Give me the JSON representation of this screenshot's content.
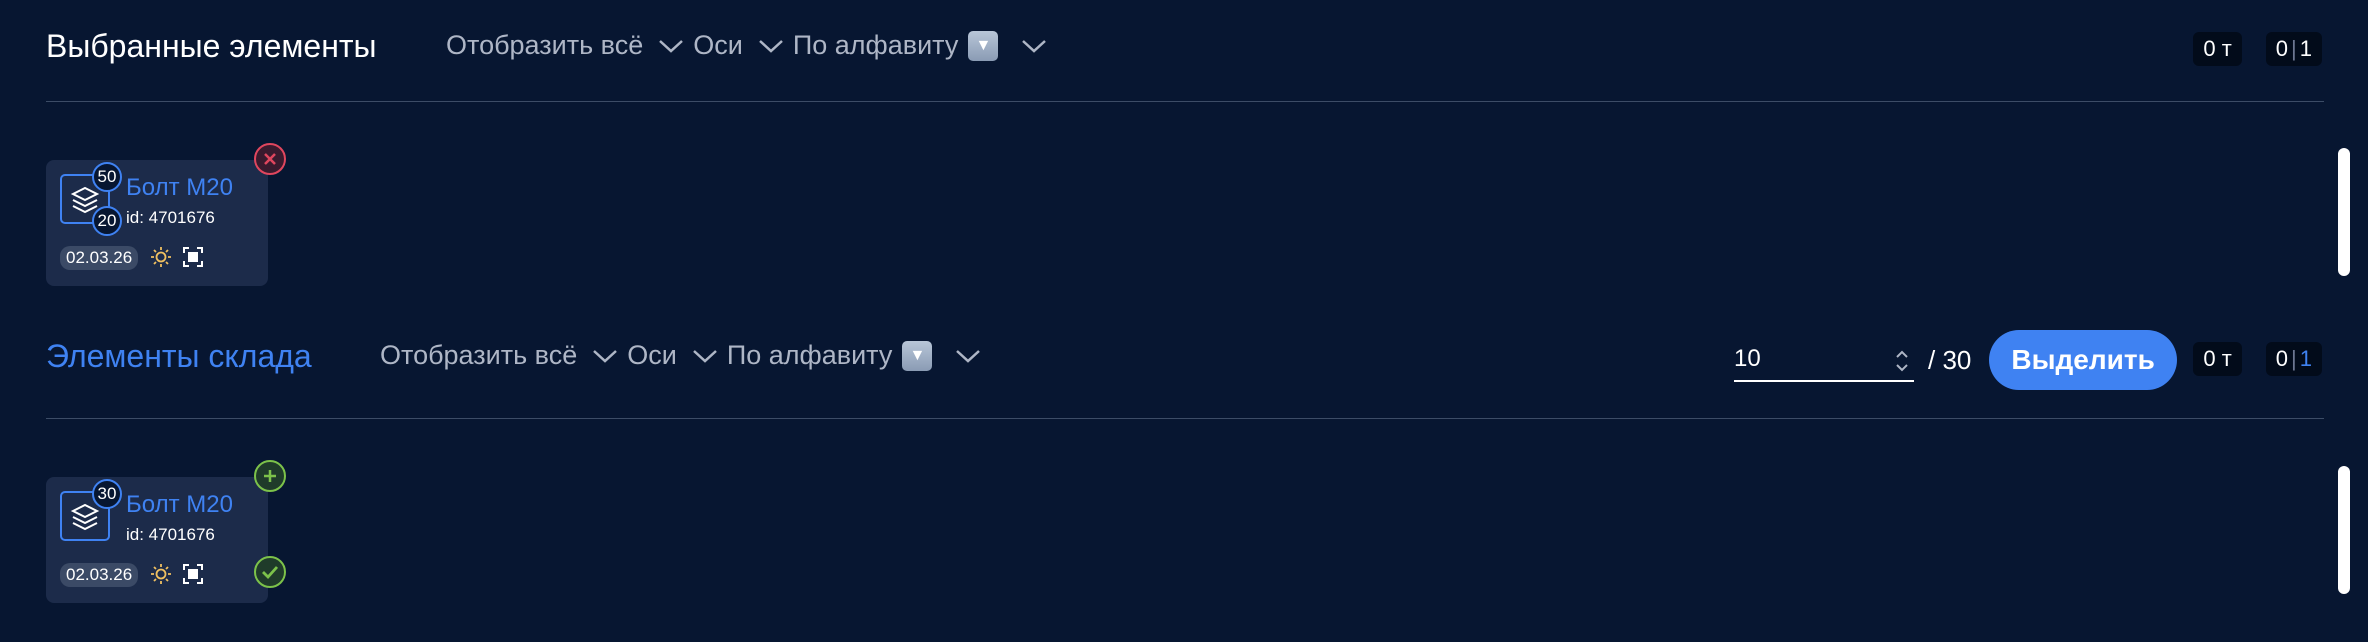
{
  "selected": {
    "title": "Выбранные элементы",
    "filter_show_all": "Отобразить всё",
    "filter_axes": "Оси",
    "filter_sort": "По алфавиту",
    "sort_icon": "descending-sort-icon",
    "weight": "0 т",
    "count_left": "0",
    "count_right": "1",
    "items": [
      {
        "name": "Болт М20",
        "id": "id: 4701676",
        "badge_top": "50",
        "badge_bottom": "20",
        "date": "02.03.26"
      }
    ]
  },
  "warehouse": {
    "title": "Элементы склада",
    "filter_show_all": "Отобразить всё",
    "filter_axes": "Оси",
    "filter_sort": "По алфавиту",
    "quantity_value": "10",
    "quantity_total": "/ 30",
    "select_button": "Выделить",
    "weight": "0 т",
    "count_left": "0",
    "count_right": "1",
    "items": [
      {
        "name": "Болт М20",
        "id": "id: 4701676",
        "badge_top": "30",
        "date": "02.03.26"
      }
    ]
  },
  "colors": {
    "background": "#071631",
    "accent": "#3f82f2",
    "card": "#1c2b4a",
    "remove": "#e0465e",
    "add": "#7cc24a"
  }
}
